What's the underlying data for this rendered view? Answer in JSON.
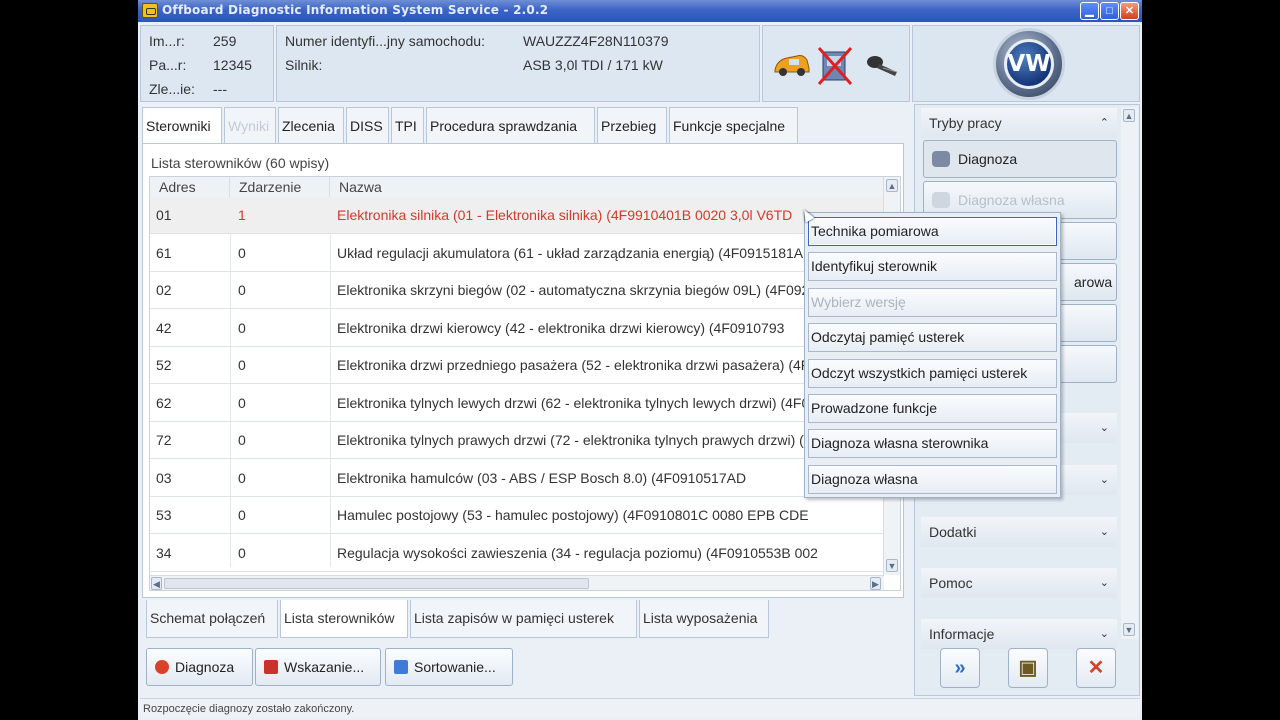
{
  "window": {
    "title": "Offboard Diagnostic Information System Service - 2.0.2",
    "min_glyph": "▁",
    "max_glyph": "□",
    "close_glyph": "✕"
  },
  "header": {
    "order": [
      {
        "label": "Im...r:",
        "value": "259"
      },
      {
        "label": "Pa...r:",
        "value": "12345"
      },
      {
        "label": "Zle...ie:",
        "value": "---"
      }
    ],
    "vehicle": [
      {
        "label": "Numer identyfi...jny samochodu:",
        "value": "WAUZZZ4F28N110379"
      },
      {
        "label": "Silnik:",
        "value": "ASB 3,0l TDI / 171 kW"
      }
    ],
    "vw_letters": "VW"
  },
  "tabs": [
    {
      "label": "Sterowniki",
      "state": "active"
    },
    {
      "label": "Wyniki",
      "state": "disabled"
    },
    {
      "label": "Zlecenia",
      "state": "normal"
    },
    {
      "label": "DISS",
      "state": "normal"
    },
    {
      "label": "TPI",
      "state": "normal"
    },
    {
      "label": "Procedura sprawdzania",
      "state": "normal"
    },
    {
      "label": "Przebieg",
      "state": "normal"
    },
    {
      "label": "Funkcje specjalne",
      "state": "normal"
    }
  ],
  "list": {
    "caption": "Lista sterowników (60 wpisy)",
    "columns": [
      "Adres",
      "Zdarzenie",
      "Nazwa"
    ],
    "rows": [
      {
        "addr": "01",
        "event": "1",
        "name": "Elektronika silnika (01 - Elektronika silnika) (4F9910401B    0020   3,0l V6TD",
        "selected": true
      },
      {
        "addr": "61",
        "event": "0",
        "name": "Układ regulacji akumulatora (61 - układ zarządzania energią) (4F0915181A"
      },
      {
        "addr": "02",
        "event": "0",
        "name": "Elektronika skrzyni biegów (02 - automatyczna skrzynia biegów 09L) (4F0927156"
      },
      {
        "addr": "42",
        "event": "0",
        "name": "Elektronika drzwi kierowcy (42 - elektronika drzwi kierowcy) (4F0910793"
      },
      {
        "addr": "52",
        "event": "0",
        "name": "Elektronika drzwi przedniego pasażera (52 - elektronika drzwi pasażera) (4F09"
      },
      {
        "addr": "62",
        "event": "0",
        "name": "Elektronika tylnych lewych drzwi (62 - elektronika tylnych lewych drzwi) (4F09"
      },
      {
        "addr": "72",
        "event": "0",
        "name": "Elektronika tylnych prawych drzwi (72 - elektronika tylnych prawych drzwi) (4F0"
      },
      {
        "addr": "03",
        "event": "0",
        "name": "Elektronika hamulców (03 - ABS / ESP Bosch 8.0) (4F0910517AD"
      },
      {
        "addr": "53",
        "event": "0",
        "name": "Hamulec postojowy (53 - hamulec postojowy) (4F0910801C     0080   EPB   CDE"
      },
      {
        "addr": "34",
        "event": "0",
        "name": "Regulacja wysokości zawieszenia (34 - regulacja poziomu) (4F0910553B     002"
      }
    ]
  },
  "bottom_tabs": [
    {
      "label": "Schemat połączeń",
      "state": "normal"
    },
    {
      "label": "Lista sterowników",
      "state": "active"
    },
    {
      "label": "Lista zapisów w pamięci usterek",
      "state": "normal"
    },
    {
      "label": "Lista wyposażenia",
      "state": "normal"
    }
  ],
  "actions": [
    {
      "label": "Diagnoza",
      "icon": "stop-icon",
      "color": "#d9412b"
    },
    {
      "label": "Wskazanie...",
      "icon": "display-icon",
      "color": "#c8332b"
    },
    {
      "label": "Sortowanie...",
      "icon": "sort-icon",
      "color": "#3d7bd6"
    }
  ],
  "status": "Rozpoczęcie diagnozy zostało zakończony.",
  "right_panel": {
    "modes_title": "Tryby pracy",
    "mode_buttons": [
      {
        "label": "Diagnoza",
        "state": "pressed"
      },
      {
        "label": "Diagnoza własna",
        "state": "disabled"
      },
      {
        "label": "",
        "state": "normal"
      },
      {
        "label": "arowa",
        "state": "normal"
      },
      {
        "label": "",
        "state": "normal"
      },
      {
        "label": "",
        "state": "normal"
      }
    ],
    "sections": [
      "",
      "",
      "Dodatki",
      "Pomoc",
      "Informacje"
    ],
    "chevron_up": "⌃",
    "chevron_down": "⌄",
    "big_buttons": [
      {
        "name": "forward-button",
        "glyph": "»",
        "color": "#2f6bd6"
      },
      {
        "name": "screenshot-button",
        "glyph": "▣",
        "color": "#6b5a23"
      },
      {
        "name": "exit-button",
        "glyph": "✕",
        "color": "#d9412b"
      }
    ]
  },
  "context_menu": {
    "items": [
      {
        "label": "Technika pomiarowa",
        "state": "highlight"
      },
      {
        "label": "Identyfikuj sterownik",
        "state": "normal"
      },
      {
        "label": "Wybierz wersję",
        "state": "disabled"
      },
      {
        "label": "Odczytaj pamięć usterek",
        "state": "normal"
      },
      {
        "label": "Odczyt wszystkich pamięci usterek",
        "state": "normal"
      },
      {
        "label": "Prowadzone funkcje",
        "state": "normal"
      },
      {
        "label": "Diagnoza własna sterownika",
        "state": "normal"
      },
      {
        "label": "Diagnoza własna",
        "state": "normal"
      }
    ]
  }
}
